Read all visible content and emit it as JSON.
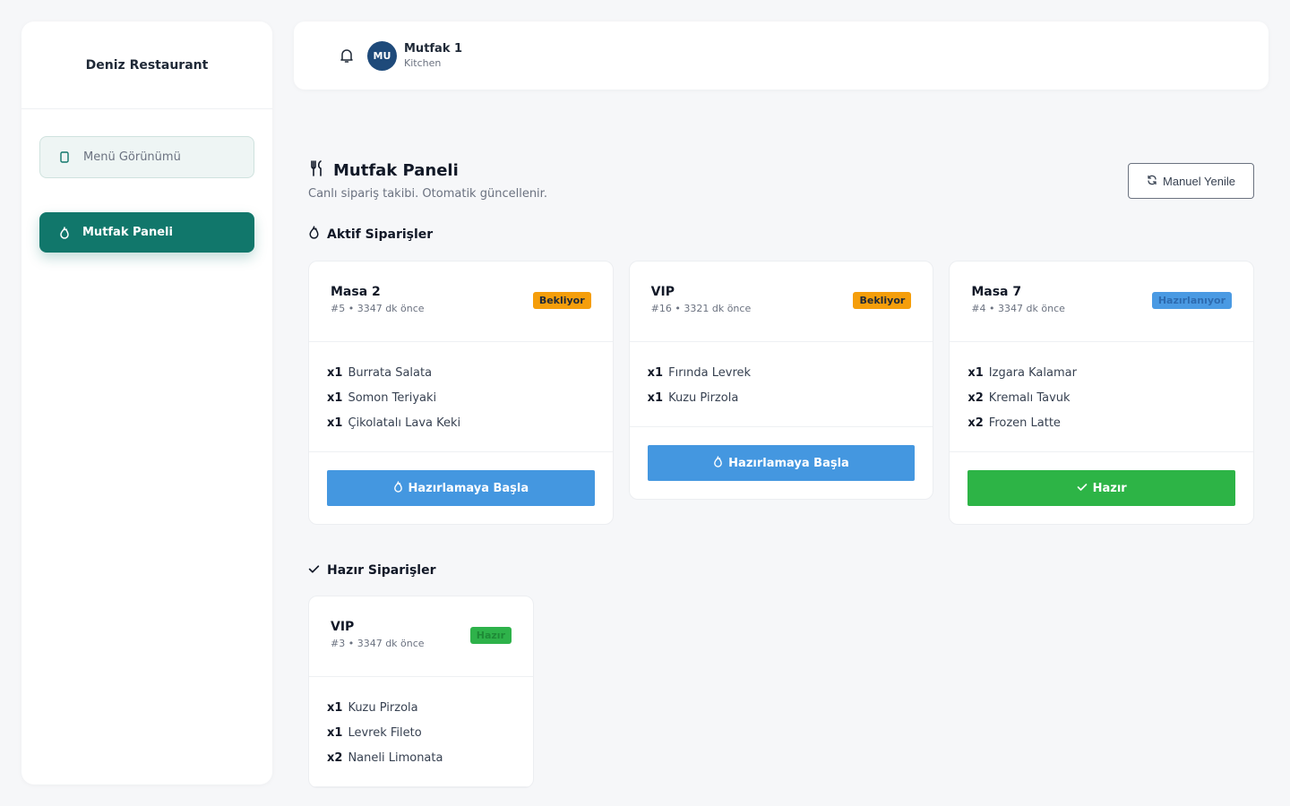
{
  "brand": "Deniz Restaurant",
  "nav": [
    {
      "label": "Menü Görünümü",
      "icon": "phone-icon"
    },
    {
      "label": "Mutfak Paneli",
      "icon": "flame-icon"
    }
  ],
  "user": {
    "initials": "MU",
    "name": "Mutfak 1",
    "role": "Kitchen"
  },
  "page": {
    "title": "Mutfak Paneli",
    "subtitle": "Canlı sipariş takibi. Otomatik güncellenir.",
    "refresh_label": "Manuel Yenile"
  },
  "active_section": "Aktif Siparişler",
  "ready_section": "Hazır Siparişler",
  "active_orders": [
    {
      "table": "Masa 2",
      "meta": "#5 • 3347 dk önce",
      "status": "Bekliyor",
      "items": [
        {
          "qty": "x1",
          "name": "Burrata Salata"
        },
        {
          "qty": "x1",
          "name": "Somon Teriyaki"
        },
        {
          "qty": "x1",
          "name": "Çikolatalı Lava Keki"
        }
      ],
      "action": "Hazırlamaya Başla"
    },
    {
      "table": "VIP",
      "meta": "#16 • 3321 dk önce",
      "status": "Bekliyor",
      "items": [
        {
          "qty": "x1",
          "name": "Fırında Levrek"
        },
        {
          "qty": "x1",
          "name": "Kuzu Pirzola"
        }
      ],
      "action": "Hazırlamaya Başla"
    },
    {
      "table": "Masa 7",
      "meta": "#4 • 3347 dk önce",
      "status": "Hazırlanıyor",
      "items": [
        {
          "qty": "x1",
          "name": "Izgara Kalamar"
        },
        {
          "qty": "x2",
          "name": "Kremalı Tavuk"
        },
        {
          "qty": "x2",
          "name": "Frozen Latte"
        }
      ],
      "action": "Hazır"
    }
  ],
  "ready_orders": [
    {
      "table": "VIP",
      "meta": "#3 • 3347 dk önce",
      "status": "Hazır",
      "items": [
        {
          "qty": "x1",
          "name": "Kuzu Pirzola"
        },
        {
          "qty": "x1",
          "name": "Levrek Fileto"
        },
        {
          "qty": "x2",
          "name": "Naneli Limonata"
        }
      ]
    }
  ],
  "colors": {
    "primary": "#11776b",
    "blue": "#4497e0",
    "green": "#2db446",
    "amber": "#f59e0b"
  }
}
